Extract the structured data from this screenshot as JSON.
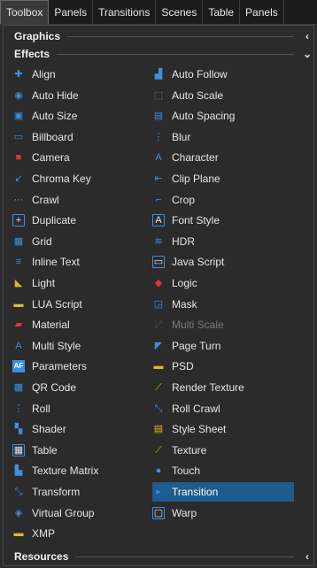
{
  "tabs": [
    "Toolbox",
    "Panels",
    "Transitions",
    "Scenes",
    "Table",
    "Panels"
  ],
  "sections": {
    "graphics": {
      "label": "Graphics",
      "chevron": "‹"
    },
    "effects": {
      "label": "Effects",
      "chevron": "⌄"
    },
    "resources": {
      "label": "Resources",
      "chevron": "‹"
    }
  },
  "left_items": [
    {
      "label": "Align",
      "icon": "align-icon"
    },
    {
      "label": "Auto Hide",
      "icon": "eye-icon"
    },
    {
      "label": "Auto Size",
      "icon": "auto-size-icon"
    },
    {
      "label": "Billboard",
      "icon": "billboard-icon"
    },
    {
      "label": "Camera",
      "icon": "camera-icon"
    },
    {
      "label": "Chroma Key",
      "icon": "chroma-key-icon"
    },
    {
      "label": "Crawl",
      "icon": "crawl-icon"
    },
    {
      "label": "Duplicate",
      "icon": "duplicate-icon"
    },
    {
      "label": "Grid",
      "icon": "grid-icon"
    },
    {
      "label": "Inline Text",
      "icon": "inline-text-icon"
    },
    {
      "label": "Light",
      "icon": "light-icon"
    },
    {
      "label": "LUA Script",
      "icon": "lua-script-icon"
    },
    {
      "label": "Material",
      "icon": "material-icon"
    },
    {
      "label": "Multi Style",
      "icon": "multi-style-icon"
    },
    {
      "label": "Parameters",
      "icon": "parameters-icon"
    },
    {
      "label": "QR Code",
      "icon": "qr-code-icon"
    },
    {
      "label": "Roll",
      "icon": "roll-icon"
    },
    {
      "label": "Shader",
      "icon": "shader-icon"
    },
    {
      "label": "Table",
      "icon": "table-icon"
    },
    {
      "label": "Texture Matrix",
      "icon": "texture-matrix-icon"
    },
    {
      "label": "Transform",
      "icon": "transform-icon"
    },
    {
      "label": "Virtual Group",
      "icon": "virtual-group-icon"
    },
    {
      "label": "XMP",
      "icon": "xmp-icon"
    }
  ],
  "right_items": [
    {
      "label": "Auto Follow",
      "icon": "auto-follow-icon"
    },
    {
      "label": "Auto Scale",
      "icon": "auto-scale-icon"
    },
    {
      "label": "Auto Spacing",
      "icon": "auto-spacing-icon"
    },
    {
      "label": "Blur",
      "icon": "blur-icon"
    },
    {
      "label": "Character",
      "icon": "character-icon"
    },
    {
      "label": "Clip Plane",
      "icon": "clip-plane-icon"
    },
    {
      "label": "Crop",
      "icon": "crop-icon"
    },
    {
      "label": "Font Style",
      "icon": "font-style-icon"
    },
    {
      "label": "HDR",
      "icon": "hdr-icon"
    },
    {
      "label": "Java Script",
      "icon": "java-script-icon"
    },
    {
      "label": "Logic",
      "icon": "logic-icon"
    },
    {
      "label": "Mask",
      "icon": "mask-icon"
    },
    {
      "label": "Multi Scale",
      "icon": "multi-scale-icon",
      "disabled": true
    },
    {
      "label": "Page Turn",
      "icon": "page-turn-icon"
    },
    {
      "label": "PSD",
      "icon": "psd-icon"
    },
    {
      "label": "Render Texture",
      "icon": "render-texture-icon"
    },
    {
      "label": "Roll Crawl",
      "icon": "roll-crawl-icon"
    },
    {
      "label": "Style Sheet",
      "icon": "style-sheet-icon"
    },
    {
      "label": "Texture",
      "icon": "texture-icon"
    },
    {
      "label": "Touch",
      "icon": "touch-icon"
    },
    {
      "label": "Transition",
      "icon": "transition-icon",
      "selected": true
    },
    {
      "label": "Warp",
      "icon": "warp-icon"
    }
  ]
}
